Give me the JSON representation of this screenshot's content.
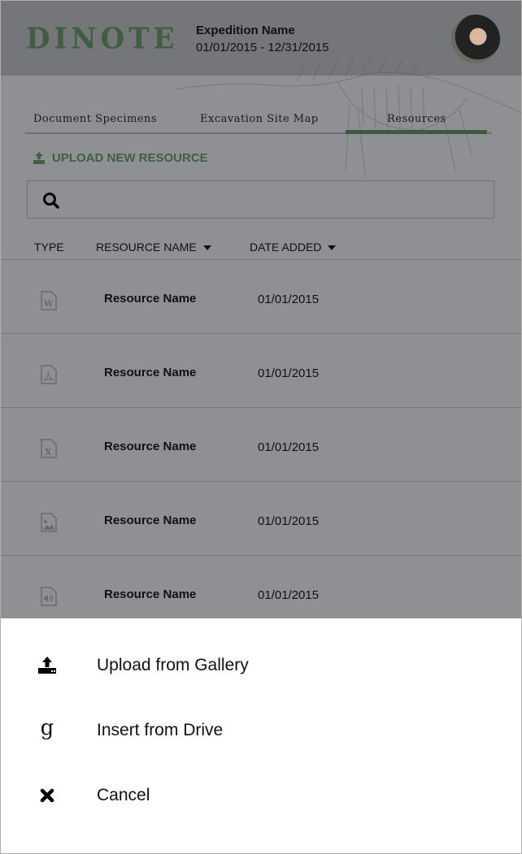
{
  "header": {
    "logo": "DINOTE",
    "expedition_name": "Expedition Name",
    "date_range": "01/01/2015 - 12/31/2015"
  },
  "tabs": [
    {
      "label": "Document Specimens"
    },
    {
      "label": "Excavation Site Map"
    },
    {
      "label": "Resources",
      "active": true
    }
  ],
  "upload_label": "UPLOAD NEW RESOURCE",
  "search": {
    "placeholder": ""
  },
  "columns": {
    "type": "TYPE",
    "name": "RESOURCE NAME",
    "date": "DATE ADDED"
  },
  "rows": [
    {
      "icon": "word-file-icon",
      "name": "Resource Name",
      "date": "01/01/2015"
    },
    {
      "icon": "pdf-file-icon",
      "name": "Resource Name",
      "date": "01/01/2015"
    },
    {
      "icon": "excel-file-icon",
      "name": "Resource Name",
      "date": "01/01/2015"
    },
    {
      "icon": "image-file-icon",
      "name": "Resource Name",
      "date": "01/01/2015"
    },
    {
      "icon": "audio-file-icon",
      "name": "Resource Name",
      "date": "01/01/2015"
    }
  ],
  "sheet": {
    "items": [
      {
        "label": "Upload from Gallery",
        "icon": "upload-icon"
      },
      {
        "label": "Insert from Drive",
        "icon": "google-icon",
        "glyph": "g"
      },
      {
        "label": "Cancel",
        "icon": "close-icon"
      }
    ]
  },
  "colors": {
    "accent": "#3f5e43",
    "overlay_bg": "#8f9094",
    "header_bg": "#75767a",
    "sheet_bg": "#ffffff"
  }
}
